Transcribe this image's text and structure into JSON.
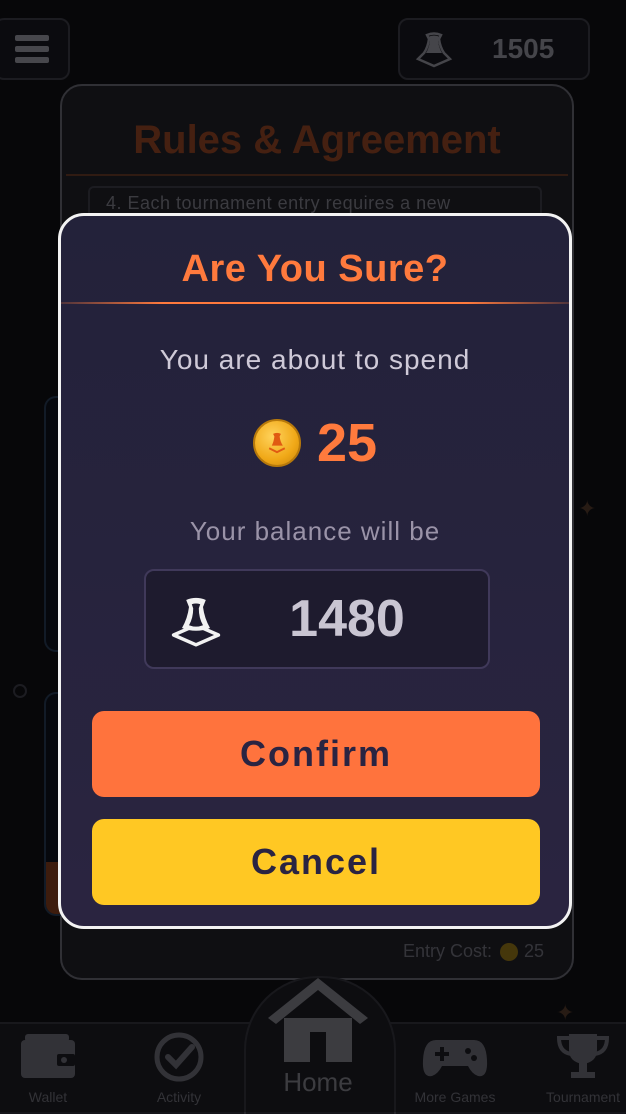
{
  "header": {
    "balance": "1505"
  },
  "rules": {
    "title": "Rules & Agreement",
    "visible_line": "4. Each tournament entry requires a new",
    "entry_cost_label": "Entry Cost:",
    "entry_cost_value": "25"
  },
  "dialog": {
    "title": "Are You Sure?",
    "spend_text": "You are about to spend",
    "amount": "25",
    "balance_text": "Your balance will be",
    "new_balance": "1480",
    "confirm_label": "Confirm",
    "cancel_label": "Cancel"
  },
  "nav": {
    "wallet": "Wallet",
    "activity": "Activity",
    "home": "Home",
    "more_games": "More Games",
    "tournament": "Tournament"
  },
  "colors": {
    "accent_orange": "#ff7a3d",
    "confirm_bg": "#ff733d",
    "cancel_bg": "#ffc823",
    "dialog_bg": "#23223a"
  },
  "icons": {
    "menu": "hamburger-menu-icon",
    "currency": "token-icon",
    "coin": "gold-coin-icon"
  }
}
